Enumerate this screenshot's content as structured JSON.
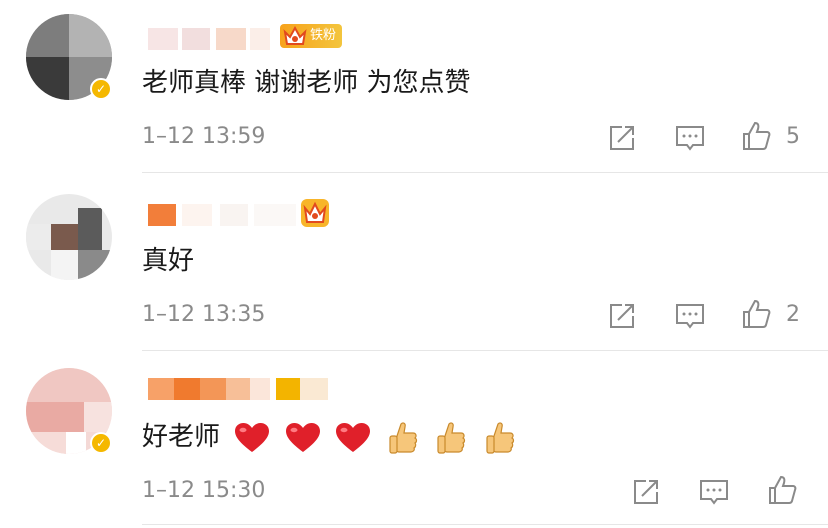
{
  "comments": [
    {
      "badge_label": "铁粉",
      "text": "老师真棒 谢谢老师 为您点赞",
      "time": "1–12 13:59",
      "like_count": "5",
      "avatar_badge": "✓"
    },
    {
      "text": "真好",
      "time": "1–12 13:35",
      "like_count": "2"
    },
    {
      "text": "好老师",
      "time": "1–12 15:30",
      "like_count": "",
      "avatar_badge": "✓"
    }
  ],
  "icons": {
    "share": "share-icon",
    "reply": "comment-icon",
    "like": "thumbs-up-icon",
    "heart": "red-heart-emoji",
    "thumb": "thumbs-up-emoji"
  },
  "colors": {
    "accent_gold": "#f5b800",
    "meta_gray": "#8a8a8a",
    "heart_red": "#e0202a"
  }
}
